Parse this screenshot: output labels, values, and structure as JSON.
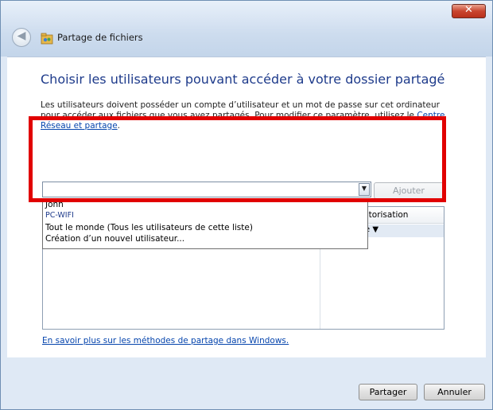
{
  "window": {
    "title": "Partage de fichiers",
    "close_label": "✕",
    "back_label": "◀"
  },
  "main": {
    "heading": "Choisir les utilisateurs pouvant accéder à votre dossier partagé",
    "desc_text": "Les utilisateurs doivent posséder un compte d’utilisateur et un mot de passe sur cet ordinateur pour accéder aux fichiers que vous avez partagés. Pour modifier ce paramètre, utilisez le ",
    "desc_link": "Centre Réseau et partage",
    "desc_end": ".",
    "combo_value": "",
    "combo_arrow": "▼",
    "add_label": "Ajouter",
    "dropdown_items": [
      "John",
      "PC-WIFI",
      "Tout le monde (Tous les utilisateurs de cette liste)",
      "Création d’un nouvel utilisateur..."
    ],
    "col_header_visible": "utorisation",
    "level_visible": "e ▼",
    "learn_link": "En savoir plus sur les méthodes de partage dans Windows."
  },
  "footer": {
    "share_label": "Partager",
    "cancel_label": "Annuler"
  },
  "colors": {
    "highlight_frame": "#e10000",
    "heading": "#1e3b8b",
    "link": "#0645ad"
  }
}
